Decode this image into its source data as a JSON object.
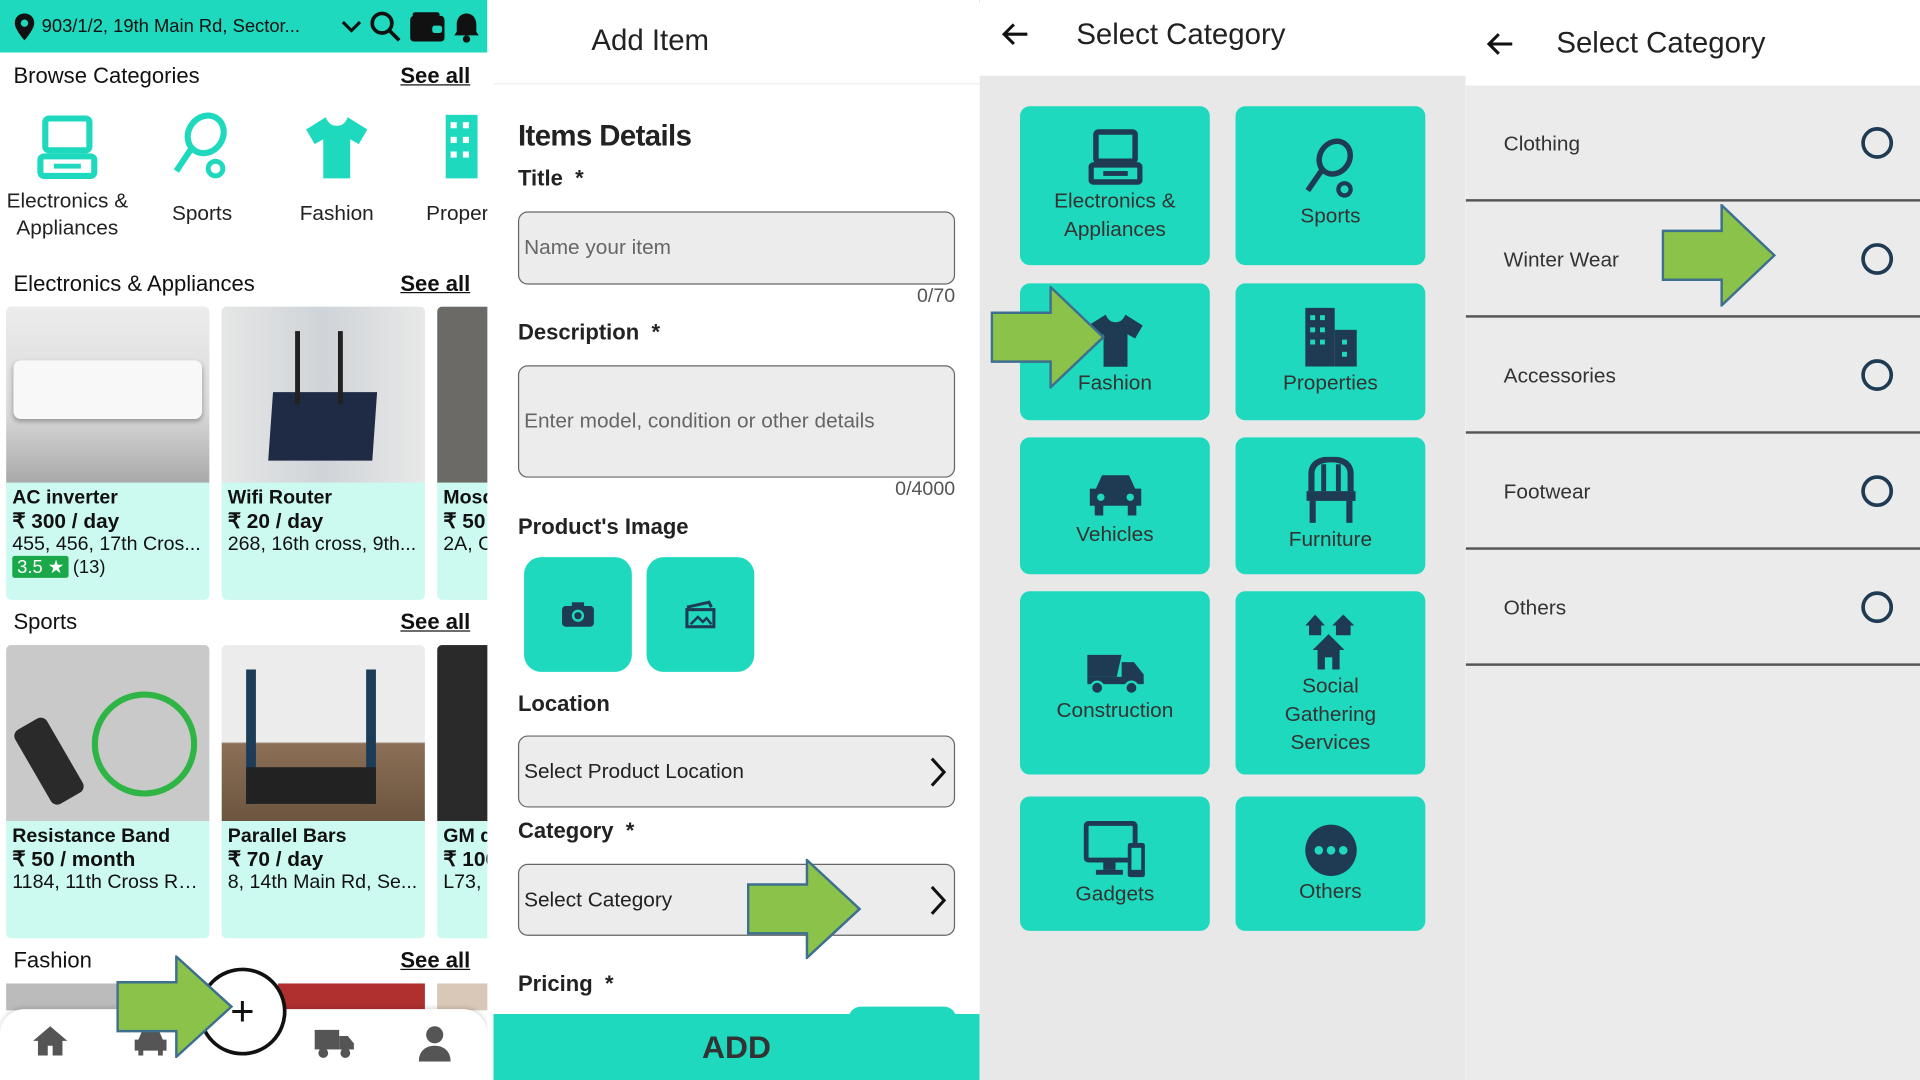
{
  "home": {
    "location": "903/1/2, 19th Main Rd, Sector...",
    "browse_title": "Browse Categories",
    "see_all": "See all",
    "categories": [
      {
        "label": "Electronics &\nAppliances",
        "icon": "laptop-icon"
      },
      {
        "label": "Sports",
        "icon": "racket-icon"
      },
      {
        "label": "Fashion",
        "icon": "tshirt-icon"
      },
      {
        "label": "Proper",
        "icon": "building-icon"
      }
    ],
    "sections": [
      {
        "title": "Electronics & Appliances",
        "items": [
          {
            "name": "AC inverter",
            "price": "₹ 300 / day",
            "address": "455, 456, 17th Cros...",
            "rating": "3.5 ★",
            "count": "(13)"
          },
          {
            "name": "Wifi Router",
            "price": "₹ 20 / day",
            "address": "268, 16th cross, 9th..."
          },
          {
            "name": "Mosq",
            "price": "₹ 50",
            "address": "2A, C"
          }
        ]
      },
      {
        "title": "Sports",
        "items": [
          {
            "name": "Resistance Band",
            "price": "₹ 50 / month",
            "address": "1184, 11th Cross Rd,..."
          },
          {
            "name": "Parallel Bars",
            "price": "₹ 70 / day",
            "address": "8, 14th Main Rd, Se..."
          },
          {
            "name": "GM d",
            "price": "₹ 100",
            "address": "L73, "
          }
        ]
      },
      {
        "title": "Fashion"
      }
    ],
    "fab": "+"
  },
  "add_item": {
    "header": "Add Item",
    "section": "Items Details",
    "title_label": "Title",
    "required": "*",
    "title_placeholder": "Name your item",
    "title_count": "0/70",
    "desc_label": "Description",
    "desc_placeholder": "Enter model, condition or other details",
    "desc_count": "0/4000",
    "image_label": "Product's Image",
    "location_label": "Location",
    "location_value": "Select Product Location",
    "category_label": "Category",
    "category_value": "Select Category",
    "pricing_label": "Pricing",
    "add_button": "ADD"
  },
  "select_category": {
    "header": "Select Category",
    "tiles": [
      "Electronics &\nAppliances",
      "Sports",
      "Fashion",
      "Properties",
      "Vehicles",
      "Furniture",
      "Construction",
      "Social\nGathering\nServices",
      "Gadgets",
      "Others"
    ]
  },
  "subcategory": {
    "header": "Select Category",
    "options": [
      "Clothing",
      "Winter Wear",
      "Accessories",
      "Footwear",
      "Others"
    ]
  },
  "colors": {
    "accent": "#1ed9bd",
    "card_bg": "#ccfaf1",
    "icon_dark": "#1f3b54",
    "arrow": "#8bc34a"
  }
}
